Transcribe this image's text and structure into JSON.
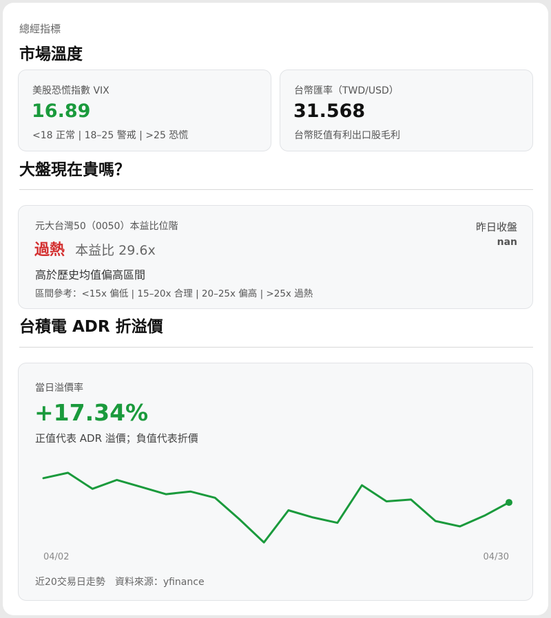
{
  "header": {
    "eyebrow": "總經指標",
    "market_title": "市場溫度"
  },
  "vix_card": {
    "label": "美股恐慌指數 VIX",
    "value": "16.89",
    "legend": "<18 正常 | 18–25 警戒 | >25 恐慌",
    "value_color": "#1a9a3c"
  },
  "fx_card": {
    "label": "台幣匯率（TWD/USD）",
    "value": "31.568",
    "note": "台幣貶值有利出口股毛利"
  },
  "valuation": {
    "title": "大盤現在貴嗎？",
    "card_label": "元大台灣50（0050）本益比位階",
    "status": "過熱",
    "status_color": "#d32f2f",
    "pe_text": "本益比 29.6x",
    "description": "高於歷史均值偏高區間",
    "ranges": "區間參考：<15x 偏低 | 15–20x 合理 | 20–25x 偏高 | >25x 過熱",
    "prev_close_label": "昨日收盤",
    "prev_close_value": "nan"
  },
  "adr": {
    "title": "台積電 ADR 折溢價",
    "card_label": "當日溢價率",
    "value": "+17.34%",
    "value_color": "#1a9a3c",
    "note": "正值代表 ADR 溢價；負值代表折價",
    "footer": "近20交易日走勢　資料來源：yfinance"
  },
  "chart_data": {
    "type": "line",
    "x_start_label": "04/02",
    "x_end_label": "04/30",
    "line_color": "#1a9a3c",
    "values": [
      18.7,
      19.0,
      18.1,
      18.6,
      18.2,
      17.8,
      17.95,
      17.6,
      16.4,
      15.1,
      16.9,
      16.5,
      16.2,
      18.3,
      17.4,
      17.5,
      16.3,
      16.0,
      16.6,
      17.34
    ]
  }
}
